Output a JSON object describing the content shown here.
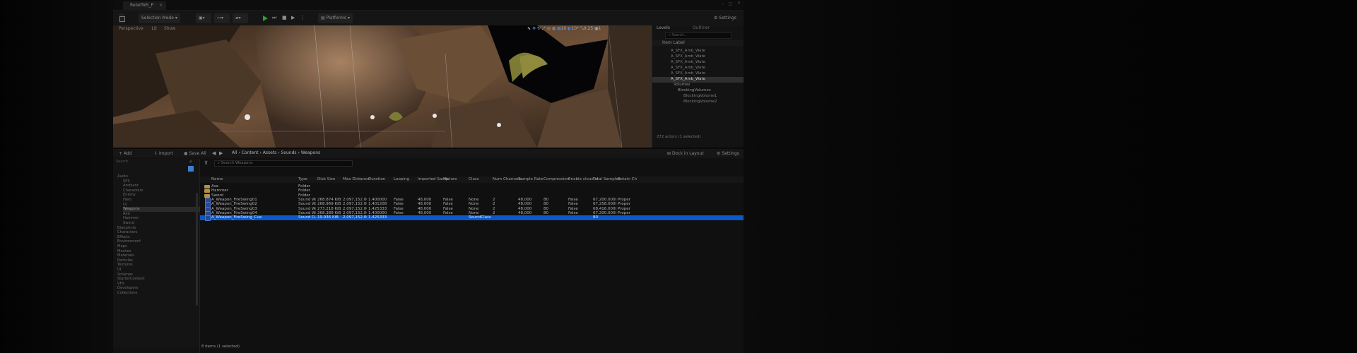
{
  "window": {
    "project_tab": "ReliefWS_P",
    "minimize": "–",
    "maximize": "□",
    "close": "×"
  },
  "toolbar": {
    "save_icon": "save-icon",
    "selection_mode": "Selection Mode",
    "platforms": "Platforms",
    "dropdown_arrow": "▾",
    "settings": "Settings"
  },
  "viewport": {
    "perspective": "Perspective",
    "lit": "Lit",
    "show": "Show",
    "grid_snap": "10",
    "rot_snap": "10°",
    "scale_snap": "0.25",
    "camera_speed": "1",
    "colors": {
      "rock": "#7b5b40",
      "sky": "#050507"
    }
  },
  "outliner": {
    "tab_levels": "Levels",
    "tab_outliner": "Outliner",
    "search_placeholder": "Search...",
    "column_label": "Item Label",
    "items": [
      "A_SFX_Amb_Wate",
      "A_SFX_Amb_Wate",
      "A_SFX_Amb_Wate",
      "A_SFX_Amb_Wate",
      "A_SFX_Amb_Wate",
      "A_SFX_Amb_Wate",
      "Volumes",
      "BlockingVolumes",
      "BlockingVolume1",
      "BlockingVolume2"
    ],
    "status": "272 actors (1 selected)"
  },
  "content_browser": {
    "actions": {
      "add": "Add",
      "import": "Import",
      "save_all": "Save All",
      "dock_in_layout": "Dock in Layout",
      "settings": "Settings"
    },
    "breadcrumbs": [
      "All",
      "Content",
      "Assets",
      "Sounds",
      "Weapons"
    ],
    "search_placeholder": "Search Weapons",
    "tree_search_placeholder": "Search",
    "columns": [
      "Name",
      "Type",
      "Disk Size",
      "Max Distance",
      "Duration",
      "Looping",
      "Imported Samp",
      "Mature",
      "Class",
      "Num Channels",
      "Sample Rate",
      "Compression",
      "Enable cloud st",
      "Total Samples",
      "Retain Ch"
    ],
    "rows": [
      {
        "name": "Axe",
        "type": "Folder",
        "disk": "",
        "maxd": "",
        "dur": "",
        "loop": "",
        "imp": "",
        "mature": "",
        "class": "",
        "chan": "",
        "rate": "",
        "comp": "",
        "cloud": "",
        "total": "",
        "retain": ""
      },
      {
        "name": "Hammer",
        "type": "Folder",
        "disk": "",
        "maxd": "",
        "dur": "",
        "loop": "",
        "imp": "",
        "mature": "",
        "class": "",
        "chan": "",
        "rate": "",
        "comp": "",
        "cloud": "",
        "total": "",
        "retain": ""
      },
      {
        "name": "Sword",
        "type": "Folder",
        "disk": "",
        "maxd": "",
        "dur": "",
        "loop": "",
        "imp": "",
        "mature": "",
        "class": "",
        "chan": "",
        "rate": "",
        "comp": "",
        "cloud": "",
        "total": "",
        "retain": ""
      },
      {
        "name": "A_Weapon_FireSwing01",
        "type": "Sound Wa",
        "disk": "268.874 KiB",
        "maxd": "2,097,152.000",
        "dur": "1.400000",
        "loop": "False",
        "imp": "48,000",
        "mature": "False",
        "class": "None",
        "chan": "2",
        "rate": "48,000",
        "comp": "80",
        "cloud": "False",
        "total": "67,200.00000",
        "retain": "Proper"
      },
      {
        "name": "A_Weapon_FireSwing02",
        "type": "Sound Wa",
        "disk": "268.969 KiB",
        "maxd": "2,097,152.000",
        "dur": "1.401208",
        "loop": "False",
        "imp": "48,000",
        "mature": "False",
        "class": "None",
        "chan": "2",
        "rate": "48,000",
        "comp": "80",
        "cloud": "False",
        "total": "67,258.00000",
        "retain": "Proper"
      },
      {
        "name": "A_Weapon_FireSwing03",
        "type": "Sound Wa",
        "disk": "273.218 KiB",
        "maxd": "2,097,152.000",
        "dur": "1.425333",
        "loop": "False",
        "imp": "48,000",
        "mature": "False",
        "class": "None",
        "chan": "2",
        "rate": "48,000",
        "comp": "80",
        "cloud": "False",
        "total": "68,416.00000",
        "retain": "Proper"
      },
      {
        "name": "A_Weapon_FireSwing04",
        "type": "Sound Wa",
        "disk": "268.389 KiB",
        "maxd": "2,097,152.000",
        "dur": "1.400000",
        "loop": "False",
        "imp": "48,000",
        "mature": "False",
        "class": "None",
        "chan": "2",
        "rate": "48,000",
        "comp": "80",
        "cloud": "False",
        "total": "67,200.00000",
        "retain": "Proper"
      },
      {
        "name": "A_Weapon_FireSwing_Cue",
        "type": "Sound Cue",
        "disk": "19.936 KiB",
        "maxd": "2,097,152.000",
        "dur": "1.425333",
        "loop": "",
        "imp": "",
        "mature": "",
        "class": "SoundClass",
        "chan": "",
        "rate": "",
        "comp": "",
        "cloud": "",
        "total": "80",
        "retain": ""
      }
    ],
    "tree_items": [
      "Audio",
      "SFX",
      "Ambient",
      "Characters",
      "Enemy",
      "Hero",
      "UI",
      "Weapons",
      "Axe",
      "Hammer",
      "Sword",
      "Blueprints",
      "Characters",
      "Effects",
      "Environment",
      "Maps",
      "Meshes",
      "Materials",
      "Particles",
      "Textures",
      "UI",
      "Volumes",
      "StarterContent",
      "VFX",
      "Developers",
      "Collections"
    ],
    "status": "8 items (1 selected)"
  }
}
